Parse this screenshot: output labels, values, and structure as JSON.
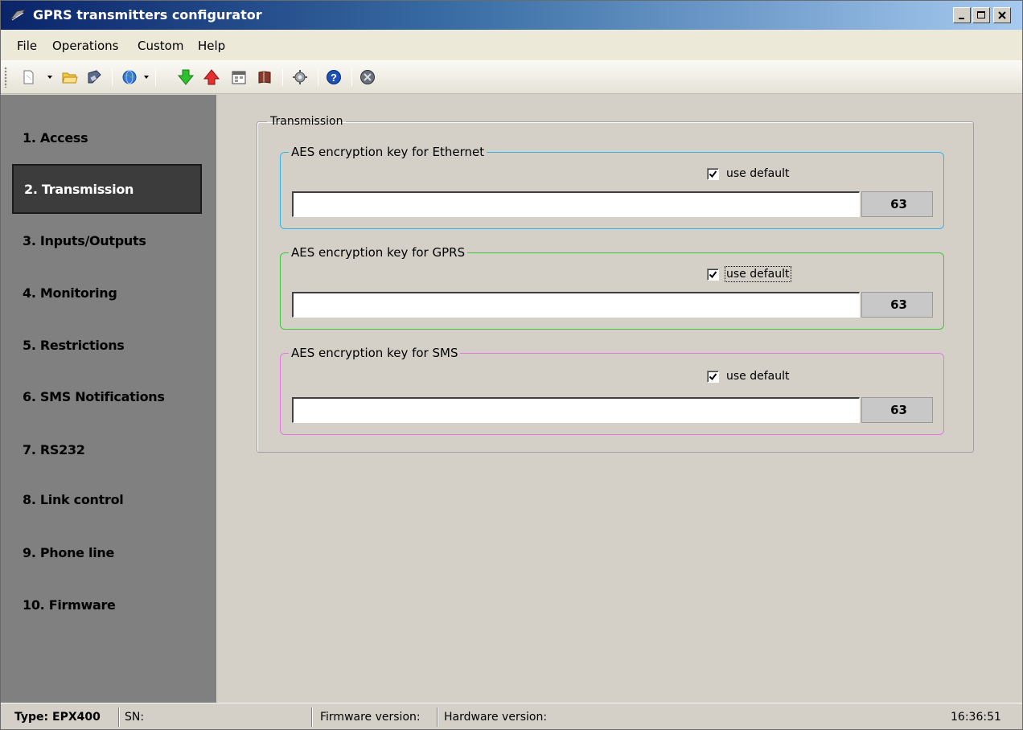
{
  "window": {
    "title": "GPRS transmitters configurator"
  },
  "menu": {
    "items": [
      {
        "label": "File"
      },
      {
        "label": "Operations"
      },
      {
        "label": "Custom"
      },
      {
        "label": "Help"
      }
    ]
  },
  "toolbar": {
    "icons": [
      "new-document-icon",
      "open-folder-icon",
      "save-disk-icon",
      "connection-globe-icon",
      "download-arrow-icon",
      "upload-arrow-icon",
      "calendar-icon",
      "book-icon",
      "settings-gear-icon",
      "help-icon",
      "disconnect-icon"
    ]
  },
  "sidebar": {
    "items": [
      {
        "label": "1. Access"
      },
      {
        "label": "2. Transmission",
        "active": true
      },
      {
        "label": "3. Inputs/Outputs"
      },
      {
        "label": "4. Monitoring"
      },
      {
        "label": "5. Restrictions"
      },
      {
        "label": "6. SMS Notifications"
      },
      {
        "label": "7. RS232"
      },
      {
        "label": "8. Link control"
      },
      {
        "label": "9. Phone line"
      },
      {
        "label": "10. Firmware"
      }
    ]
  },
  "transmission": {
    "group_title": "Transmission",
    "sections": [
      {
        "title": "AES encryption key for Ethernet",
        "checkbox_label": "use default",
        "checked": true,
        "value": "",
        "counter": "63",
        "border_color": "#33b5e5"
      },
      {
        "title": "AES encryption key for GPRS",
        "checkbox_label": "use default",
        "checked": true,
        "value": "",
        "counter": "63",
        "border_color": "#3cc83c"
      },
      {
        "title": "AES encryption key for SMS",
        "checkbox_label": "use default",
        "checked": true,
        "value": "",
        "counter": "63",
        "border_color": "#e678e6"
      }
    ]
  },
  "statusbar": {
    "type": "Type: EPX400",
    "sn": "SN:",
    "firmware": "Firmware version:",
    "hardware": "Hardware version:",
    "time": "16:36:51"
  }
}
